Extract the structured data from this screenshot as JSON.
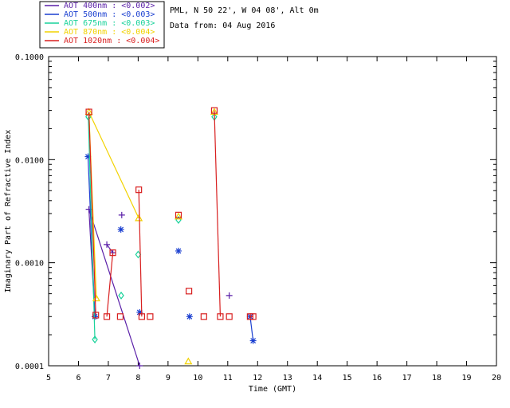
{
  "header": {
    "site": "PML, N 50 22', W 04 08', Alt 0m",
    "date": "Data from: 04 Aug 2016"
  },
  "legend": [
    {
      "label": "AOT  400nm : <0.002>",
      "color": "#5a1fa8"
    },
    {
      "label": "AOT  500nm : <0.003>",
      "color": "#1a3fd0"
    },
    {
      "label": "AOT  675nm : <0.003>",
      "color": "#19d29a"
    },
    {
      "label": "AOT  870nm : <0.004>",
      "color": "#f2d200"
    },
    {
      "label": "AOT 1020nm : <0.004>",
      "color": "#d81f1f"
    }
  ],
  "chart_data": {
    "type": "scatter",
    "xlabel": "Time (GMT)",
    "ylabel": "Imaginary Part of Refractive Index",
    "xlim": [
      5,
      20
    ],
    "ylim": [
      0.0001,
      0.1
    ],
    "yscale": "log",
    "xticks": [
      "5",
      "6",
      "7",
      "8",
      "9",
      "10",
      "11",
      "12",
      "13",
      "14",
      "15",
      "16",
      "17",
      "18",
      "19",
      "20"
    ],
    "yticks": [
      {
        "value": 0.0001,
        "label": "0.0001"
      },
      {
        "value": 0.001,
        "label": "0.0010"
      },
      {
        "value": 0.01,
        "label": "0.0100"
      },
      {
        "value": 0.1,
        "label": "0.1000"
      }
    ],
    "series": [
      {
        "name": "AOT  400nm : <0.002>",
        "marker": "plus",
        "color": "#5a1fa8",
        "x": [
          6.35,
          6.55,
          6.95,
          7.15,
          7.45,
          8.05,
          11.05
        ],
        "y": [
          0.0033,
          0.0003,
          0.0015,
          0.00125,
          0.0029,
          0.0001,
          0.00048
        ],
        "segments": [
          [
            0,
            1
          ],
          [
            2,
            3
          ],
          [
            5,
            0
          ]
        ]
      },
      {
        "name": "AOT  500nm : <0.003>",
        "marker": "asterisk",
        "color": "#1a3fd0",
        "x": [
          6.32,
          6.55,
          7.42,
          8.05,
          9.35,
          9.72,
          11.85,
          11.75
        ],
        "y": [
          0.0107,
          0.0003,
          0.0021,
          0.00033,
          0.0013,
          0.0003,
          0.000175,
          0.0003
        ],
        "segments": [
          [
            0,
            1
          ],
          [
            7,
            6
          ]
        ]
      },
      {
        "name": "AOT  675nm : <0.003>",
        "marker": "diamond",
        "color": "#19d29a",
        "x": [
          6.33,
          6.55,
          7.43,
          8.0,
          9.35,
          10.55
        ],
        "y": [
          0.026,
          0.00018,
          0.00048,
          0.0012,
          0.0026,
          0.026
        ],
        "segments": [
          [
            0,
            1
          ]
        ]
      },
      {
        "name": "AOT  870nm : <0.004>",
        "marker": "triangle",
        "color": "#f2d200",
        "x": [
          6.35,
          6.6,
          8.02,
          9.35,
          9.68,
          10.55
        ],
        "y": [
          0.029,
          0.00045,
          0.0027,
          0.0028,
          0.00011,
          0.029
        ],
        "segments": [
          [
            0,
            1
          ],
          [
            2,
            0
          ]
        ]
      },
      {
        "name": "AOT 1020nm : <0.004>",
        "marker": "square",
        "color": "#d81f1f",
        "x": [
          6.35,
          6.58,
          6.95,
          7.15,
          7.4,
          8.02,
          8.12,
          8.4,
          9.35,
          9.7,
          10.2,
          10.55,
          10.75,
          11.05,
          11.75,
          11.85
        ],
        "y": [
          0.029,
          0.00031,
          0.0003,
          0.00125,
          0.0003,
          0.0051,
          0.0003,
          0.0003,
          0.0029,
          0.00053,
          0.0003,
          0.03,
          0.0003,
          0.0003,
          0.0003,
          0.0003
        ],
        "segments": [
          [
            0,
            1
          ],
          [
            2,
            3
          ],
          [
            5,
            6
          ],
          [
            11,
            12
          ],
          [
            14,
            15
          ]
        ]
      }
    ]
  }
}
